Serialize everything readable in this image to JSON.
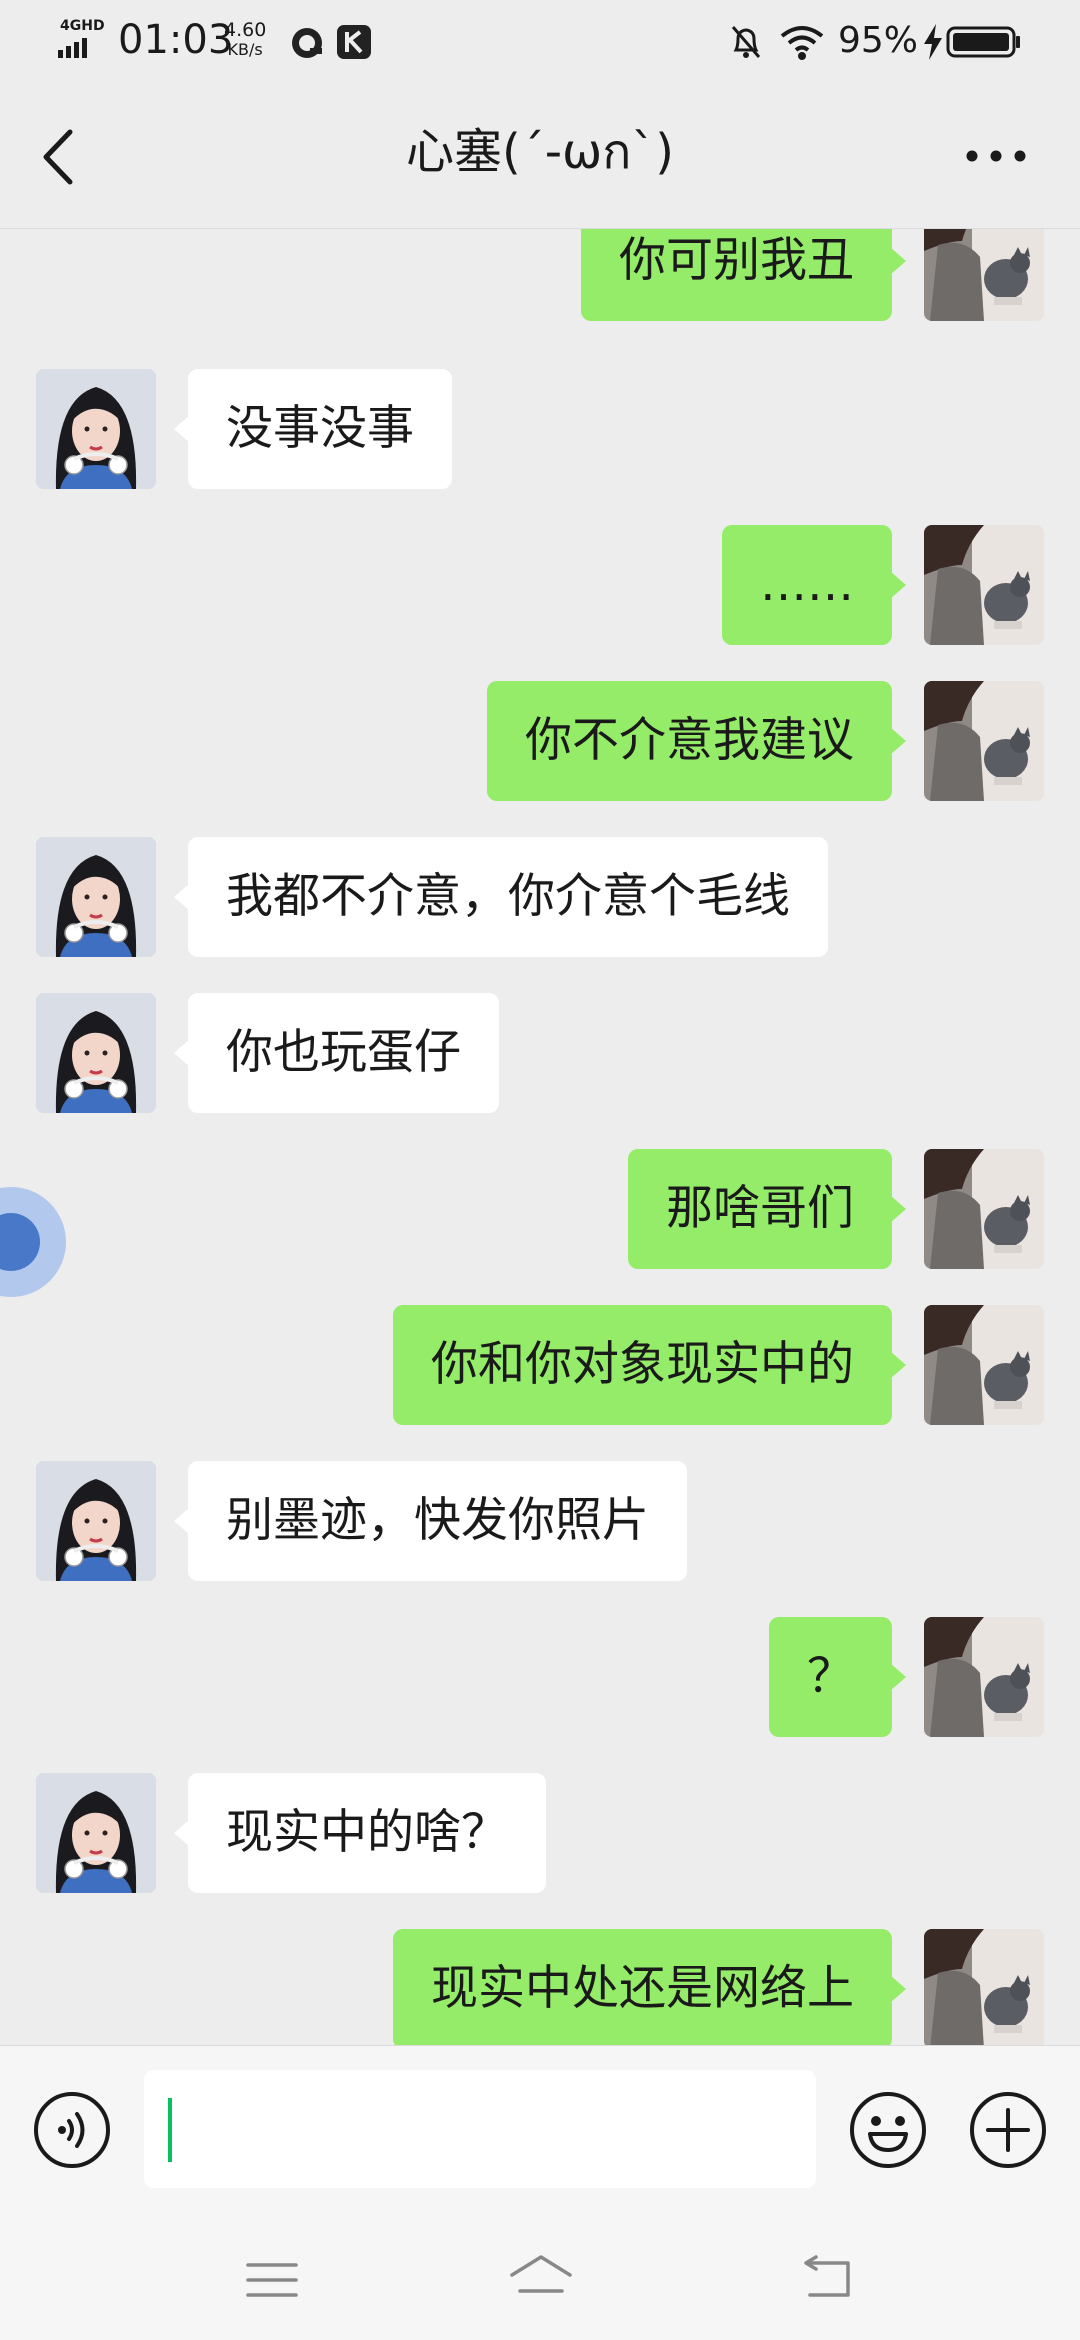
{
  "status_bar": {
    "network_label": "4GHD",
    "time": "01:03",
    "speed_value": "4.60",
    "speed_unit": "KB/s",
    "battery_percent": "95%"
  },
  "header": {
    "title": "心塞(´-ωก`)",
    "back_icon": "chevron-left-icon",
    "more_icon": "more-horizontal-icon"
  },
  "messages": [
    {
      "sender": "me",
      "text": "你可别我丑"
    },
    {
      "sender": "other",
      "text": "没事没事"
    },
    {
      "sender": "me",
      "text": "……"
    },
    {
      "sender": "me",
      "text": "你不介意我建议"
    },
    {
      "sender": "other",
      "text": "我都不介意，你介意个毛线"
    },
    {
      "sender": "other",
      "text": "你也玩蛋仔"
    },
    {
      "sender": "me",
      "text": "那啥哥们"
    },
    {
      "sender": "me",
      "text": "你和你对象现实中的"
    },
    {
      "sender": "other",
      "text": "别墨迹，快发你照片"
    },
    {
      "sender": "me",
      "text": "？"
    },
    {
      "sender": "other",
      "text": "现实中的啥？"
    },
    {
      "sender": "me",
      "text": "现实中处还是网络上"
    }
  ],
  "input_bar": {
    "value": "",
    "voice_icon": "voice-icon",
    "emoji_icon": "emoji-icon",
    "plus_icon": "plus-icon"
  },
  "colors": {
    "background": "#ededed",
    "my_bubble": "#95ec69",
    "other_bubble": "#ffffff",
    "caret": "#07c160"
  }
}
